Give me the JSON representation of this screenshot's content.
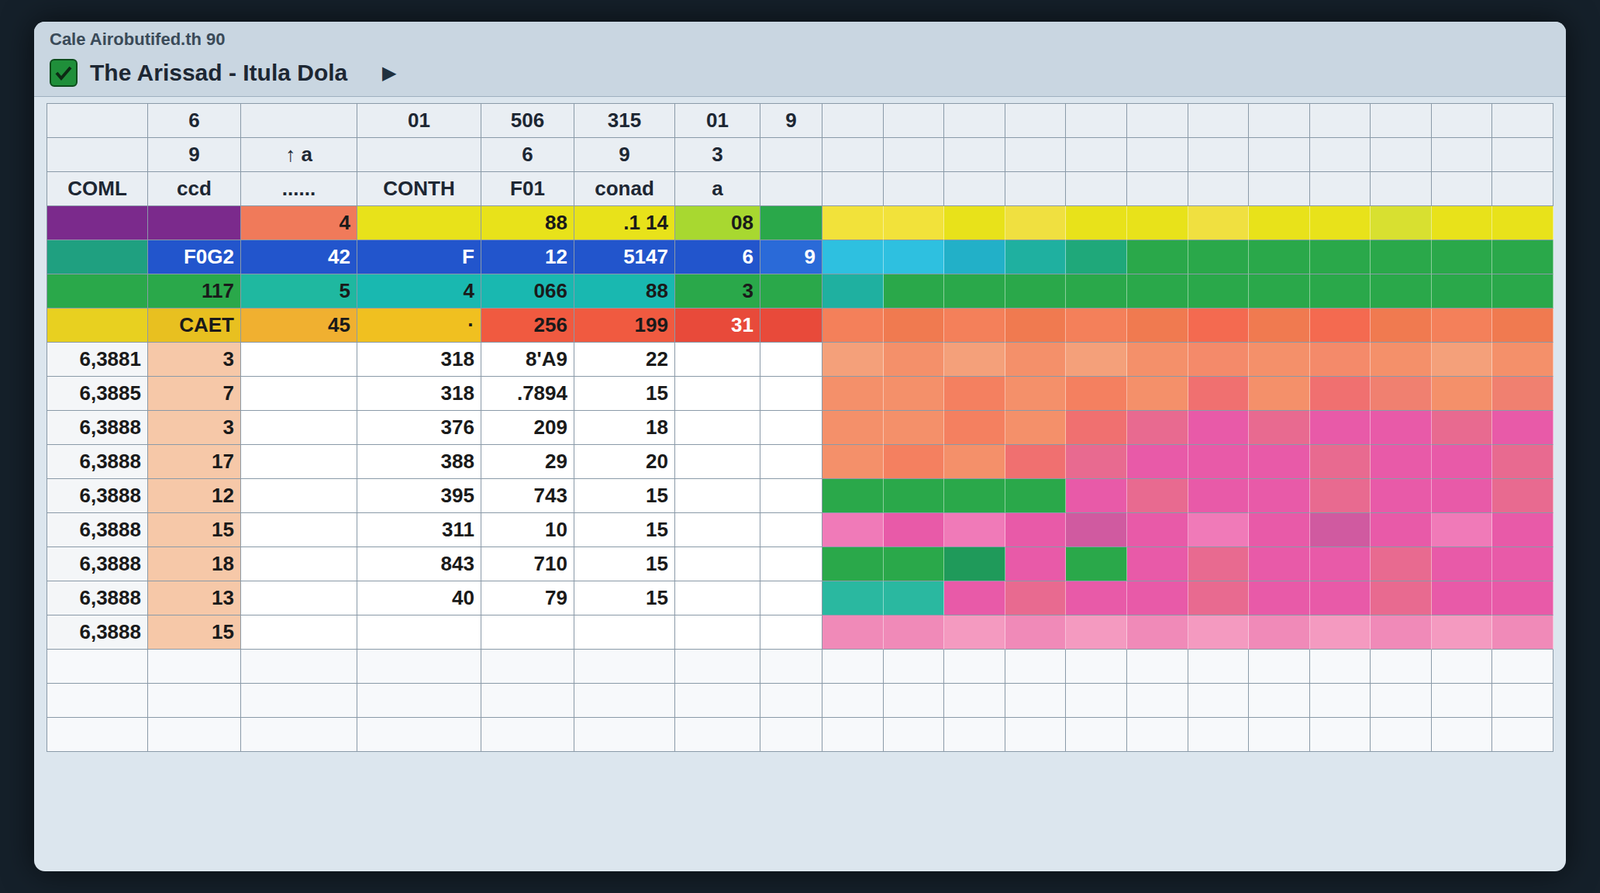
{
  "window": {
    "caption": "Cale Airobutifed.th 90",
    "title": "The Arissad - Itula Dola"
  },
  "toolbar": [
    "▶"
  ],
  "table": {
    "header_rows": [
      [
        "",
        "6",
        "",
        "01",
        "506",
        "315",
        "01",
        "9"
      ],
      [
        "",
        "9",
        "↑ a",
        "",
        "6",
        "9",
        "3",
        ""
      ],
      [
        "COML",
        "ccd",
        "......",
        "CONTH",
        "F01",
        "conad",
        "a",
        ""
      ]
    ],
    "rows": [
      {
        "cells": [
          {
            "text": "",
            "color": "#7b2a8c"
          },
          {
            "text": "",
            "color": "#7b2a8c"
          },
          {
            "text": "4",
            "color": "#f07a5a"
          },
          {
            "text": "",
            "color": "#e8e21a"
          },
          {
            "text": "88",
            "color": "#e8e21a"
          },
          {
            "text": ".1 14",
            "color": "#e8e21a"
          },
          {
            "text": "08",
            "color": "#a8d830"
          },
          {
            "text": "",
            "color": "#2aa84a"
          }
        ],
        "heat": [
          "#f2e23a",
          "#f2e23a",
          "#e8e21a",
          "#f0e040",
          "#e8e21a",
          "#e8e21a",
          "#f0e040",
          "#e8e21a",
          "#e8e21a",
          "#d8e030",
          "#e8e21a",
          "#e8e21a"
        ]
      },
      {
        "cells": [
          {
            "text": "",
            "color": "#1fa080"
          },
          {
            "text": "F0G2",
            "color": "#2255cc"
          },
          {
            "text": "42",
            "color": "#2255cc"
          },
          {
            "text": "F",
            "color": "#2255cc"
          },
          {
            "text": "12",
            "color": "#2255cc"
          },
          {
            "text": "5147",
            "color": "#2255cc"
          },
          {
            "text": "6",
            "color": "#2255cc"
          },
          {
            "text": "9",
            "color": "#2a6ad8"
          }
        ],
        "heat": [
          "#2ec0e0",
          "#2ec0e0",
          "#22b0c8",
          "#1fb0a0",
          "#1fa87a",
          "#2aa84a",
          "#2aa84a",
          "#2aa84a",
          "#2aa84a",
          "#2aa84a",
          "#2aa84a",
          "#2aa84a"
        ]
      },
      {
        "cells": [
          {
            "text": "",
            "color": "#2aa84a"
          },
          {
            "text": "117",
            "color": "#2aa84a"
          },
          {
            "text": "5",
            "color": "#1fb8a0"
          },
          {
            "text": "4",
            "color": "#19b8b0"
          },
          {
            "text": "066",
            "color": "#19b8b0"
          },
          {
            "text": "88",
            "color": "#19b8b0"
          },
          {
            "text": "3",
            "color": "#2aa84a"
          },
          {
            "text": "",
            "color": "#2aa84a"
          }
        ],
        "heat": [
          "#1fb0a0",
          "#2aa84a",
          "#2aa84a",
          "#2aa84a",
          "#2aa84a",
          "#2aa84a",
          "#2aa84a",
          "#2aa84a",
          "#2aa84a",
          "#2aa84a",
          "#2aa84a",
          "#2aa84a"
        ]
      },
      {
        "cells": [
          {
            "text": "",
            "color": "#e8d020"
          },
          {
            "text": "CAET",
            "color": "#e8c020"
          },
          {
            "text": "45",
            "color": "#f0b030"
          },
          {
            "text": "·",
            "color": "#f0c020"
          },
          {
            "text": "256",
            "color": "#f05a40"
          },
          {
            "text": "199",
            "color": "#f05a40"
          },
          {
            "text": "31",
            "color": "#e84a3a"
          },
          {
            "text": "",
            "color": "#e84a3a"
          }
        ],
        "heat": [
          "#f4805a",
          "#f07a50",
          "#f4805a",
          "#f07a50",
          "#f4805a",
          "#f07a50",
          "#f46a50",
          "#f07a50",
          "#f46a50",
          "#f07a50",
          "#f4805a",
          "#f07a50"
        ]
      },
      {
        "cells": [
          {
            "text": "6,3881",
            "color": "#f4f6f8"
          },
          {
            "text": "3",
            "color": "#f6c8a8"
          },
          {
            "text": "",
            "color": "#ffffff"
          },
          {
            "text": "318",
            "color": "#ffffff"
          },
          {
            "text": "8'A9",
            "color": "#ffffff"
          },
          {
            "text": "22",
            "color": "#ffffff"
          },
          {
            "text": "",
            "color": "#ffffff"
          },
          {
            "text": "",
            "color": "#ffffff"
          }
        ],
        "heat": [
          "#f4a07a",
          "#f4906a",
          "#f4a07a",
          "#f4906a",
          "#f4a07a",
          "#f4906a",
          "#f48a6a",
          "#f4906a",
          "#f48a6a",
          "#f4906a",
          "#f4a07a",
          "#f4906a"
        ]
      },
      {
        "cells": [
          {
            "text": "6,3885",
            "color": "#f4f6f8"
          },
          {
            "text": "7",
            "color": "#f6c8a8"
          },
          {
            "text": "",
            "color": "#ffffff"
          },
          {
            "text": "318",
            "color": "#ffffff"
          },
          {
            "text": ".7894",
            "color": "#ffffff"
          },
          {
            "text": "15",
            "color": "#ffffff"
          },
          {
            "text": "",
            "color": "#ffffff"
          },
          {
            "text": "",
            "color": "#ffffff"
          }
        ],
        "heat": [
          "#f4906a",
          "#f4906a",
          "#f48060",
          "#f4906a",
          "#f48060",
          "#f4906a",
          "#f07070",
          "#f4906a",
          "#f07070",
          "#f08070",
          "#f4906a",
          "#f08070"
        ]
      },
      {
        "cells": [
          {
            "text": "6,3888",
            "color": "#f4f6f8"
          },
          {
            "text": "3",
            "color": "#f6c8a8"
          },
          {
            "text": "",
            "color": "#ffffff"
          },
          {
            "text": "376",
            "color": "#ffffff"
          },
          {
            "text": "209",
            "color": "#ffffff"
          },
          {
            "text": "18",
            "color": "#ffffff"
          },
          {
            "text": "",
            "color": "#ffffff"
          },
          {
            "text": "",
            "color": "#ffffff"
          }
        ],
        "heat": [
          "#f4906a",
          "#f4906a",
          "#f48060",
          "#f4906a",
          "#f07070",
          "#e86a90",
          "#e85aa8",
          "#e86a90",
          "#e85aa8",
          "#e85aa8",
          "#e86a90",
          "#e85aa8"
        ]
      },
      {
        "cells": [
          {
            "text": "6,3888",
            "color": "#f4f6f8"
          },
          {
            "text": "17",
            "color": "#f6c8a8"
          },
          {
            "text": "",
            "color": "#ffffff"
          },
          {
            "text": "388",
            "color": "#ffffff"
          },
          {
            "text": "29",
            "color": "#ffffff"
          },
          {
            "text": "20",
            "color": "#ffffff"
          },
          {
            "text": "",
            "color": "#ffffff"
          },
          {
            "text": "",
            "color": "#ffffff"
          }
        ],
        "heat": [
          "#f4906a",
          "#f48060",
          "#f4906a",
          "#f07070",
          "#e86a90",
          "#e85aa8",
          "#e85aa8",
          "#e85aa8",
          "#e86a90",
          "#e85aa8",
          "#e85aa8",
          "#e86a90"
        ]
      },
      {
        "cells": [
          {
            "text": "6,3888",
            "color": "#f4f6f8"
          },
          {
            "text": "12",
            "color": "#f6c8a8"
          },
          {
            "text": "",
            "color": "#ffffff"
          },
          {
            "text": "395",
            "color": "#ffffff"
          },
          {
            "text": "743",
            "color": "#ffffff"
          },
          {
            "text": "15",
            "color": "#ffffff"
          },
          {
            "text": "",
            "color": "#ffffff"
          },
          {
            "text": "",
            "color": "#ffffff"
          }
        ],
        "heat": [
          "#2aa84a",
          "#2aa84a",
          "#2aa84a",
          "#2aa84a",
          "#e85aa8",
          "#e86a90",
          "#e85aa8",
          "#e85aa8",
          "#e86a90",
          "#e85aa8",
          "#e85aa8",
          "#e86a90"
        ]
      },
      {
        "cells": [
          {
            "text": "6,3888",
            "color": "#f4f6f8"
          },
          {
            "text": "15",
            "color": "#f6c8a8"
          },
          {
            "text": "",
            "color": "#ffffff"
          },
          {
            "text": "311",
            "color": "#ffffff"
          },
          {
            "text": "10",
            "color": "#ffffff"
          },
          {
            "text": "15",
            "color": "#ffffff"
          },
          {
            "text": "",
            "color": "#ffffff"
          },
          {
            "text": "",
            "color": "#ffffff"
          }
        ],
        "heat": [
          "#f07ab8",
          "#e85aa8",
          "#f07ab8",
          "#e85aa8",
          "#d05aa0",
          "#e85aa8",
          "#f07ab8",
          "#e85aa8",
          "#d05aa0",
          "#e85aa8",
          "#f07ab8",
          "#e85aa8"
        ]
      },
      {
        "cells": [
          {
            "text": "6,3888",
            "color": "#f4f6f8"
          },
          {
            "text": "18",
            "color": "#f6c8a8"
          },
          {
            "text": "",
            "color": "#ffffff"
          },
          {
            "text": "843",
            "color": "#ffffff"
          },
          {
            "text": "710",
            "color": "#ffffff"
          },
          {
            "text": "15",
            "color": "#ffffff"
          },
          {
            "text": "",
            "color": "#ffffff"
          },
          {
            "text": "",
            "color": "#ffffff"
          }
        ],
        "heat": [
          "#2aa84a",
          "#2aa84a",
          "#1f9a5a",
          "#e85aa8",
          "#2aa84a",
          "#e85aa8",
          "#e86a90",
          "#e85aa8",
          "#e85aa8",
          "#e86a90",
          "#e85aa8",
          "#e85aa8"
        ]
      },
      {
        "cells": [
          {
            "text": "6,3888",
            "color": "#f4f6f8"
          },
          {
            "text": "13",
            "color": "#f6c8a8"
          },
          {
            "text": "",
            "color": "#ffffff"
          },
          {
            "text": "40",
            "color": "#ffffff"
          },
          {
            "text": "79",
            "color": "#ffffff"
          },
          {
            "text": "15",
            "color": "#ffffff"
          },
          {
            "text": "",
            "color": "#ffffff"
          },
          {
            "text": "",
            "color": "#ffffff"
          }
        ],
        "heat": [
          "#2ab8a0",
          "#2ab8a0",
          "#e85aa8",
          "#e86a90",
          "#e85aa8",
          "#e85aa8",
          "#e86a90",
          "#e85aa8",
          "#e85aa8",
          "#e86a90",
          "#e85aa8",
          "#e85aa8"
        ]
      },
      {
        "cells": [
          {
            "text": "6,3888",
            "color": "#f4f6f8"
          },
          {
            "text": "15",
            "color": "#f6c8a8"
          },
          {
            "text": "",
            "color": "#ffffff"
          },
          {
            "text": "",
            "color": "#ffffff"
          },
          {
            "text": "",
            "color": "#ffffff"
          },
          {
            "text": "",
            "color": "#ffffff"
          },
          {
            "text": "",
            "color": "#ffffff"
          },
          {
            "text": "",
            "color": "#ffffff"
          }
        ],
        "heat": [
          "#f08ab8",
          "#f08ab8",
          "#f49ac0",
          "#f08ab8",
          "#f49ac0",
          "#f08ab8",
          "#f49ac0",
          "#f08ab8",
          "#f49ac0",
          "#f08ab8",
          "#f49ac0",
          "#f08ab8"
        ]
      }
    ]
  }
}
